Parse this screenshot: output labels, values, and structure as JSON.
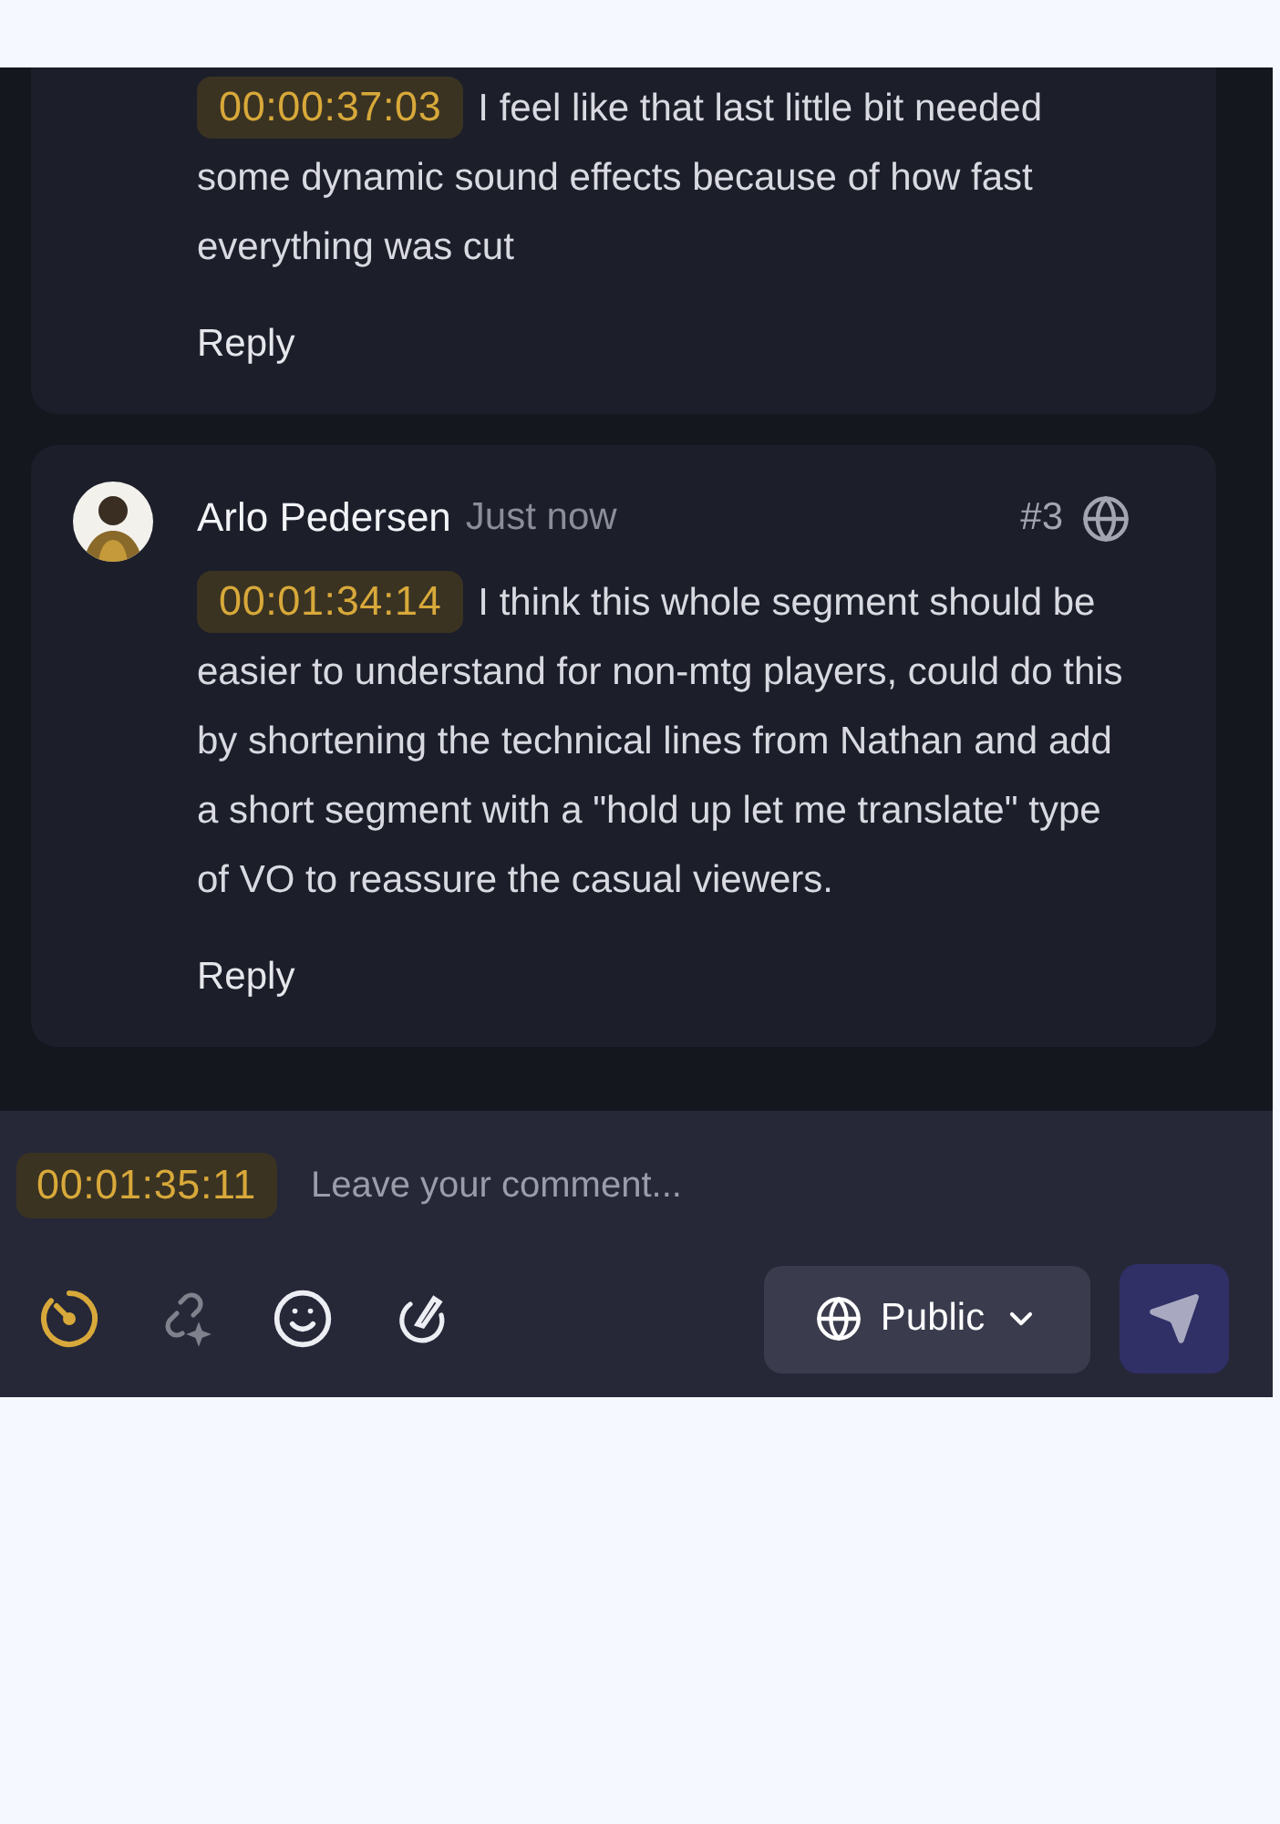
{
  "comments": [
    {
      "timecode": "00:00:37:03",
      "text": "I feel like that last little bit needed some dynamic sound effects because of how fast everything was cut",
      "reply": "Reply"
    },
    {
      "author": "Arlo Pedersen",
      "time": "Just now",
      "number": "#3",
      "timecode": "00:01:34:14",
      "text": "I think this whole segment should be easier to understand for non-mtg players, could do this by shortening the technical lines from Nathan and add a short segment with a \"hold up let me translate\" type of VO to reassure the casual viewers.",
      "reply": "Reply"
    }
  ],
  "composer": {
    "timecode": "00:01:35:11",
    "placeholder": "Leave your comment...",
    "tools": [
      {
        "kind": "timer",
        "active": true,
        "disabled": false
      },
      {
        "kind": "link",
        "active": false,
        "disabled": true
      },
      {
        "kind": "emoji",
        "active": false,
        "disabled": false
      },
      {
        "kind": "draw",
        "active": false,
        "disabled": false
      }
    ],
    "visibility": "Public"
  }
}
